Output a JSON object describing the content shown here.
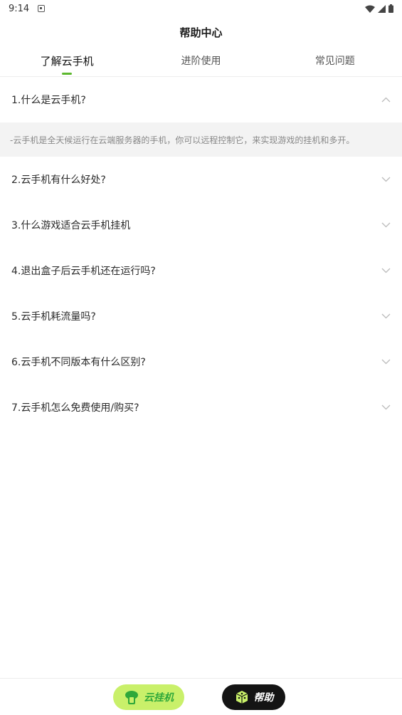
{
  "status_bar": {
    "time": "9:14"
  },
  "header": {
    "title": "帮助中心"
  },
  "tabs": [
    {
      "label": "了解云手机",
      "active": true
    },
    {
      "label": "进阶使用",
      "active": false
    },
    {
      "label": "常见问题",
      "active": false
    }
  ],
  "faq": {
    "items": [
      {
        "question": "1.什么是云手机?",
        "expanded": true,
        "answer": "-云手机是全天候运行在云端服务器的手机，你可以远程控制它，来实现游戏的挂机和多开。"
      },
      {
        "question": "2.云手机有什么好处?",
        "expanded": false
      },
      {
        "question": "3.什么游戏适合云手机挂机",
        "expanded": false
      },
      {
        "question": "4.退出盒子后云手机还在运行吗?",
        "expanded": false
      },
      {
        "question": "5.云手机耗流量吗?",
        "expanded": false
      },
      {
        "question": "6.云手机不同版本有什么区别?",
        "expanded": false
      },
      {
        "question": "7.云手机怎么免费使用/购买?",
        "expanded": false
      }
    ]
  },
  "bottom_nav": {
    "cloud_label": "云挂机",
    "help_label": "帮助"
  },
  "colors": {
    "accent": "#5cb82e",
    "cloud_button_bg": "#c9f06a",
    "help_button_bg": "#141414",
    "answer_bg": "#f3f3f3"
  }
}
